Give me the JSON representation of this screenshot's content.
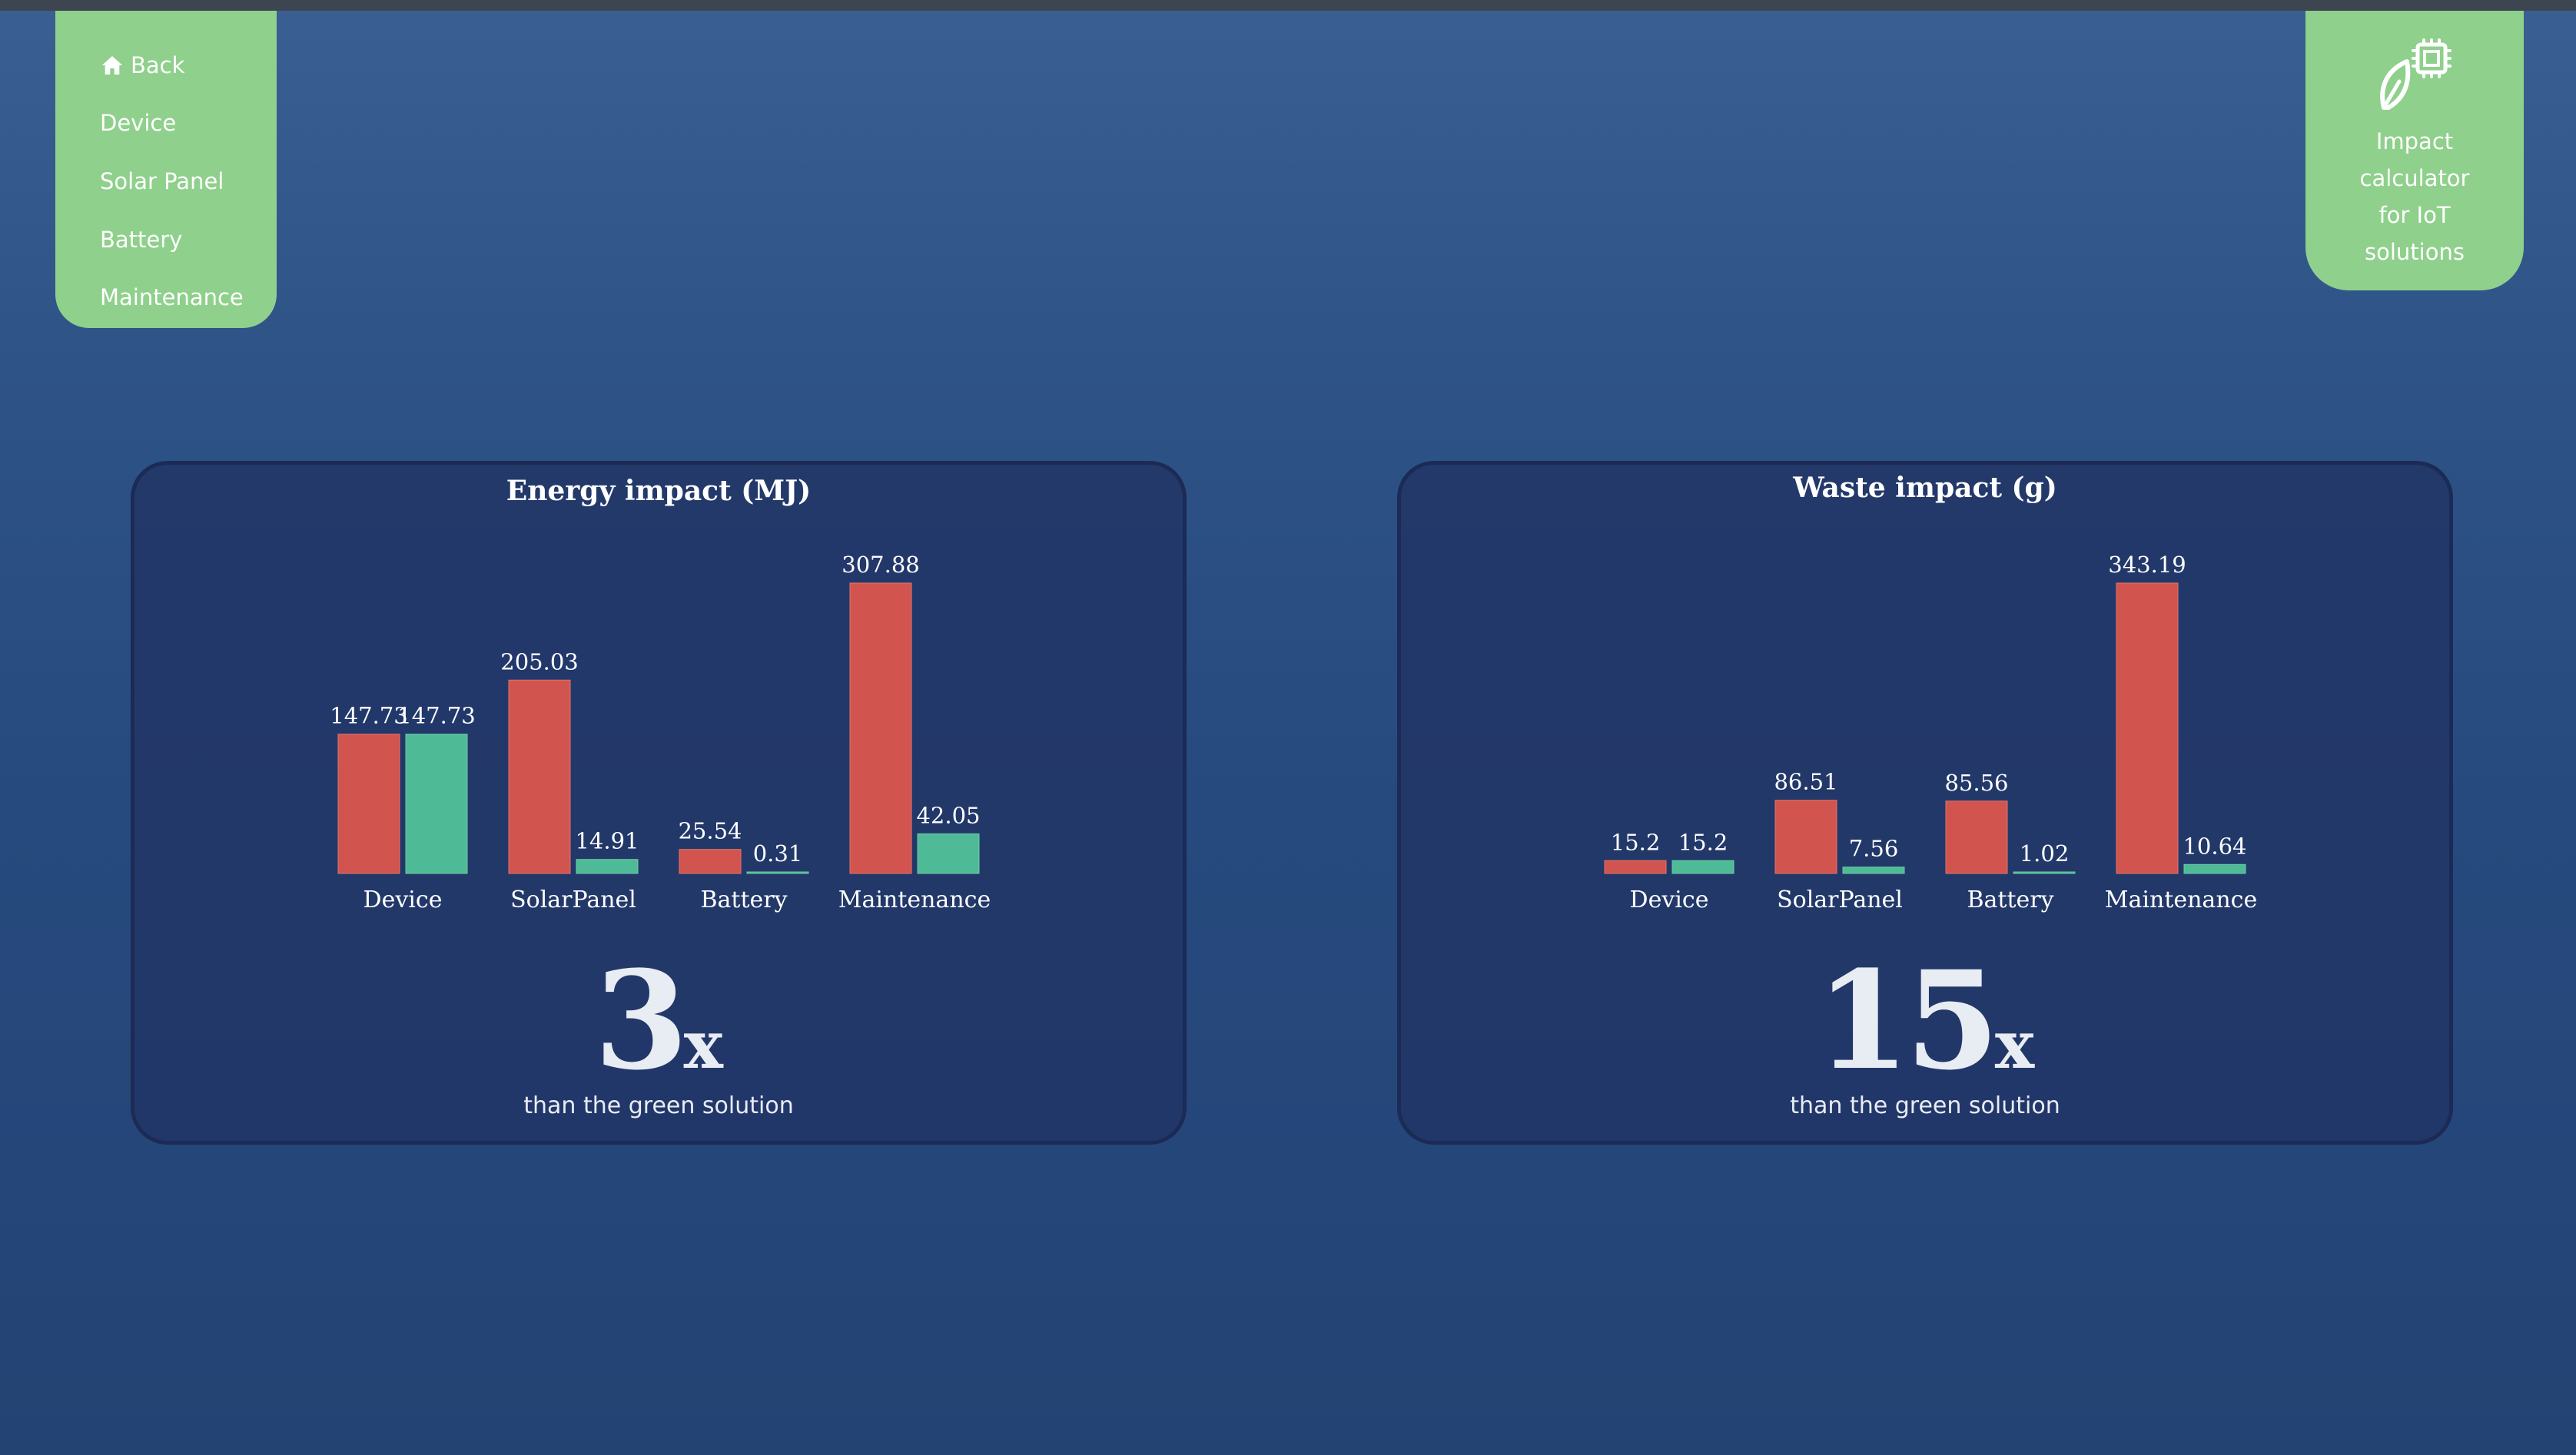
{
  "nav": {
    "items": [
      {
        "label": "Back",
        "icon": "home-icon"
      },
      {
        "label": "Device"
      },
      {
        "label": "Solar Panel"
      },
      {
        "label": "Battery"
      },
      {
        "label": "Maintenance"
      }
    ]
  },
  "brand": {
    "icon": "leaf-chip-icon",
    "lines": [
      "Impact",
      "calculator",
      "for IoT",
      "solutions"
    ]
  },
  "colors": {
    "standard": "#d2544e",
    "green": "#4fba96",
    "panel_bg": "#223667",
    "nav_bg": "#8fd08c"
  },
  "panels": [
    {
      "multiplier": "3",
      "multiplier_suffix": "x",
      "caption": "than the green solution"
    },
    {
      "multiplier": "15",
      "multiplier_suffix": "x",
      "caption": "than the green solution"
    }
  ],
  "chart_data": [
    {
      "type": "bar",
      "title": "Energy impact (MJ)",
      "categories": [
        "Device",
        "SolarPanel",
        "Battery",
        "Maintenance"
      ],
      "series": [
        {
          "values": [
            147.73,
            205.03,
            25.54,
            307.88
          ],
          "labels": [
            "147.73",
            "205.03",
            "25.54",
            "307.88"
          ],
          "color": "#d2544e"
        },
        {
          "values": [
            147.73,
            14.91,
            0.31,
            42.05
          ],
          "labels": [
            "147.73",
            "14.91",
            "0.31",
            "42.05"
          ],
          "color": "#4fba96"
        }
      ],
      "ylim": [
        0,
        307.88
      ],
      "grid": false,
      "legend": "none"
    },
    {
      "type": "bar",
      "title": "Waste impact (g)",
      "categories": [
        "Device",
        "SolarPanel",
        "Battery",
        "Maintenance"
      ],
      "series": [
        {
          "values": [
            15.2,
            86.51,
            85.56,
            343.19
          ],
          "labels": [
            "15.2",
            "86.51",
            "85.56",
            "343.19"
          ],
          "color": "#d2544e"
        },
        {
          "values": [
            15.2,
            7.56,
            1.02,
            10.64
          ],
          "labels": [
            "15.2",
            "7.56",
            "1.02",
            "10.64"
          ],
          "color": "#4fba96"
        }
      ],
      "ylim": [
        0,
        343.19
      ],
      "grid": false,
      "legend": "none"
    }
  ]
}
